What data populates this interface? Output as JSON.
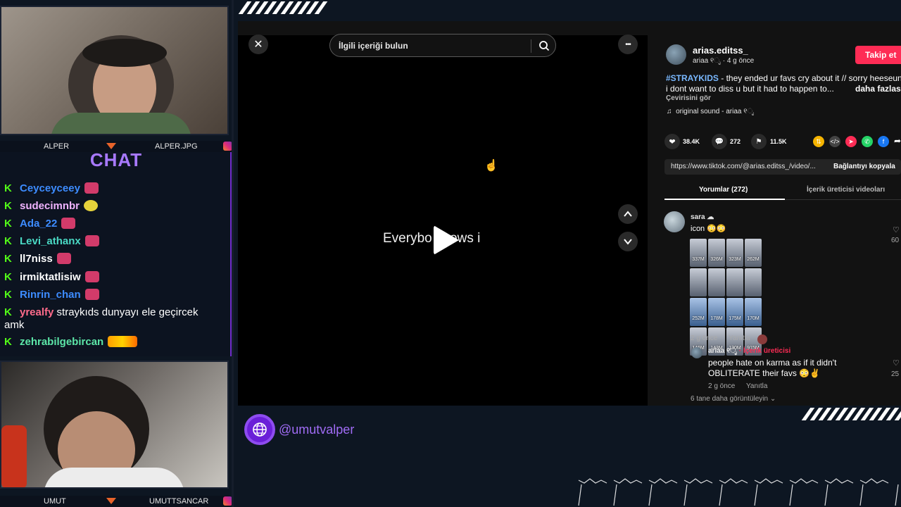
{
  "overlay": {
    "cam1_left_label": "ALPER",
    "cam1_right_label": "ALPER.JPG",
    "cam2_left_label": "UMUT",
    "cam2_right_label": "UMUTTSANCAR",
    "chat_title": "CHAT",
    "handle": "@umutvalper",
    "chat_messages": [
      {
        "user": "Ceyceyceey",
        "color": "#3d8cff",
        "text": ""
      },
      {
        "user": "sudecimnbr",
        "color": "#f0b3ff",
        "text": ""
      },
      {
        "user": "Ada_22",
        "color": "#3d8cff",
        "text": ""
      },
      {
        "user": "Levi_athanx",
        "color": "#4ad9c4",
        "text": ""
      },
      {
        "user": "ll7niss",
        "color": "#ffffff",
        "text": ""
      },
      {
        "user": "irmiktatlisiw",
        "color": "#ffffff",
        "text": ""
      },
      {
        "user": "Rinrin_chan",
        "color": "#3d8cff",
        "text": ""
      },
      {
        "user": "yrealfy",
        "color": "#ff6b8b",
        "text": "straykıds dunyayı ele geçircek",
        "text2": "amk"
      },
      {
        "user": "zehrabilgebircan",
        "color": "#5ce6a8",
        "text": ""
      }
    ]
  },
  "video": {
    "search_placeholder": "İlgili içeriği bulun",
    "caption": "Everybo   knows i",
    "close_icon": "✕",
    "more_icon": "•••"
  },
  "post": {
    "username": "arias.editss_",
    "subline": "ariaa ୧ೃ · 4 g önce",
    "follow_label": "Takip et",
    "hashtag": "#STRAYKIDS",
    "desc_line1": " - they ended ur favs cry about it // sorry heeseung",
    "desc_line2": "i dont want to diss u but it had to happen to...",
    "more_label": "daha fazlası",
    "translate_label": "Çevirisini gör",
    "sound": "original sound - ariaa ୧ೃ",
    "likes": "38.4K",
    "comments": "272",
    "saves": "11.5K",
    "link": "https://www.tiktok.com/@arias.editss_/video/...",
    "copy_link_label": "Bağlantıyı kopyala",
    "tab_comments": "Yorumlar (272)",
    "tab_creator": "İçerik üreticisi videoları"
  },
  "comment": {
    "user": "sara ☁",
    "text": "icon 😳😳",
    "time": "2 g önce",
    "reply_label": "Yanıtla",
    "like_count": "60",
    "tiles": [
      "337M",
      "326M",
      "323M",
      "262M",
      "",
      "",
      "",
      "",
      "252M",
      "178M",
      "175M",
      "170M",
      "146M",
      "143M",
      "130M",
      "915M"
    ],
    "reply_user": "ariaa ୧ೃ",
    "reply_badge": "· İçerik üreticisi",
    "reply_text1": "people hate on karma as if it didn't",
    "reply_text2": "OBLITERATE their favs 😳✌",
    "reply_time": "2 g önce",
    "reply_reply_label": "Yanıtla",
    "reply_like_count": "25",
    "view_more": "6 tane daha görüntüleyin"
  },
  "colors": {
    "accent_purple": "#6a1fd8",
    "tiktok_red": "#fe2c55",
    "kick_green": "#53fc18"
  }
}
